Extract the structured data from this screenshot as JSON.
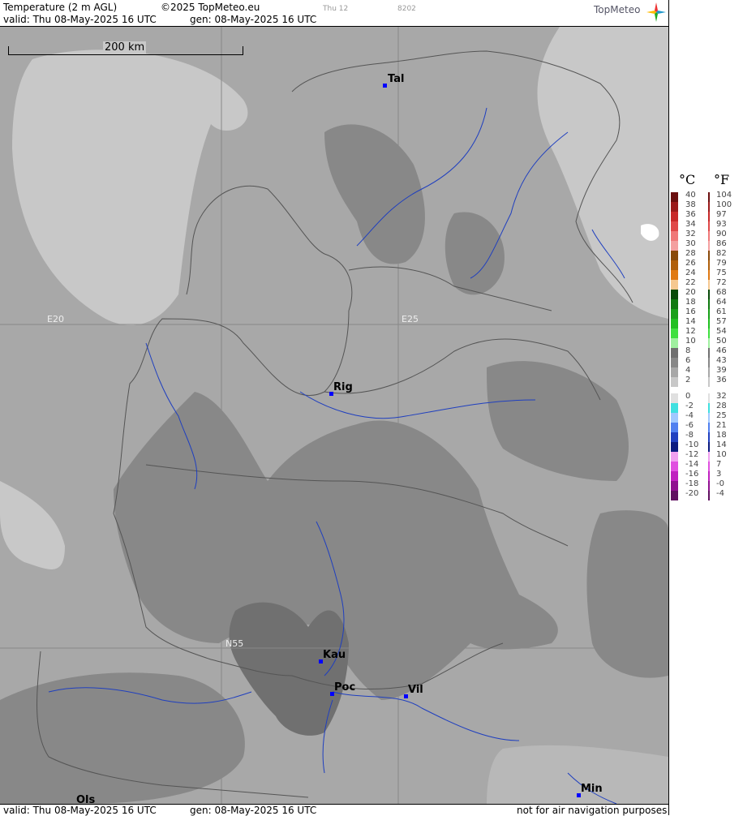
{
  "header": {
    "product": "Temperature (2 m AGL)",
    "copyright": "©2025 TopMeteo.eu",
    "valid": "valid:  Thu  08-May-2025  16 UTC",
    "generated": "gen: 08-May-2025 16 UTC",
    "faint_day": "Thu 12",
    "faint_code": "8202",
    "logo": "TopMeteo"
  },
  "map": {
    "scale_label": "200 km",
    "grid_labels": {
      "lon_e20": "E20",
      "lon_e25": "E25",
      "lat_n55": "N55"
    },
    "cities": [
      {
        "id": "tallinn",
        "label": "Tal"
      },
      {
        "id": "riga",
        "label": "Rig"
      },
      {
        "id": "kaunas",
        "label": "Kau"
      },
      {
        "id": "pociunai",
        "label": "Poc"
      },
      {
        "id": "vilnius",
        "label": "Vil"
      },
      {
        "id": "minsk",
        "label": "Min"
      },
      {
        "id": "olsztyn",
        "label": "Ols"
      }
    ]
  },
  "footer": {
    "valid": "valid:  Thu  08-May-2025  16 UTC",
    "generated": "gen: 08-May-2025 16 UTC",
    "disclaimer": "not for air navigation purposes"
  },
  "legend": {
    "celsius_unit": "°C",
    "fahrenheit_unit": "°F",
    "levels": [
      {
        "c": "40",
        "f": "104",
        "color": "#6b0f0f"
      },
      {
        "c": "38",
        "f": "100",
        "color": "#9b1a1a"
      },
      {
        "c": "36",
        "f": "97",
        "color": "#c82828"
      },
      {
        "c": "34",
        "f": "93",
        "color": "#e04848"
      },
      {
        "c": "32",
        "f": "90",
        "color": "#f07878"
      },
      {
        "c": "30",
        "f": "86",
        "color": "#f4a0a0"
      },
      {
        "c": "28",
        "f": "82",
        "color": "#8a4a0a"
      },
      {
        "c": "26",
        "f": "79",
        "color": "#b0600c"
      },
      {
        "c": "24",
        "f": "75",
        "color": "#e07a14"
      },
      {
        "c": "22",
        "f": "72",
        "color": "#f5c890"
      },
      {
        "c": "20",
        "f": "68",
        "color": "#0a4a0a"
      },
      {
        "c": "18",
        "f": "64",
        "color": "#107a10"
      },
      {
        "c": "16",
        "f": "61",
        "color": "#18a018"
      },
      {
        "c": "14",
        "f": "57",
        "color": "#20c020"
      },
      {
        "c": "12",
        "f": "54",
        "color": "#40e040"
      },
      {
        "c": "10",
        "f": "50",
        "color": "#a0f0a0"
      },
      {
        "c": "8",
        "f": "46",
        "color": "#707070"
      },
      {
        "c": "6",
        "f": "43",
        "color": "#888888"
      },
      {
        "c": "4",
        "f": "39",
        "color": "#a8a8a8"
      },
      {
        "c": "2",
        "f": "36",
        "color": "#c8c8c8"
      },
      {
        "c": "0",
        "f": "32",
        "color": "#e0e0e0"
      },
      {
        "c": "-2",
        "f": "28",
        "color": "#40e0e0"
      },
      {
        "c": "-4",
        "f": "25",
        "color": "#a0c8ff"
      },
      {
        "c": "-6",
        "f": "21",
        "color": "#5080f0"
      },
      {
        "c": "-8",
        "f": "18",
        "color": "#2040c0"
      },
      {
        "c": "-10",
        "f": "14",
        "color": "#0a1a80"
      },
      {
        "c": "-12",
        "f": "10",
        "color": "#f0a0f0"
      },
      {
        "c": "-14",
        "f": "7",
        "color": "#e050e0"
      },
      {
        "c": "-16",
        "f": "3",
        "color": "#c020c0"
      },
      {
        "c": "-18",
        "f": "-0",
        "color": "#901090"
      },
      {
        "c": "-20",
        "f": "-4",
        "color": "#601060"
      }
    ]
  }
}
